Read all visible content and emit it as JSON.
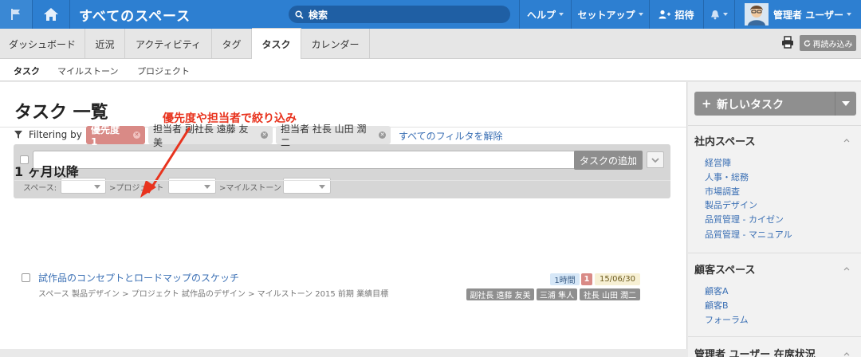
{
  "topbar": {
    "space_title": "すべてのスペース",
    "search_placeholder": "検索",
    "help": "ヘルプ",
    "setup": "セットアップ",
    "invite": "招待",
    "user_name": "管理者 ユーザー",
    "colors": {
      "bar": "#2d7fd1",
      "search": "#1f5fa4"
    }
  },
  "tabs": [
    {
      "label": "ダッシュボード"
    },
    {
      "label": "近況"
    },
    {
      "label": "アクティビティ"
    },
    {
      "label": "タグ"
    },
    {
      "label": "タスク",
      "active": true
    },
    {
      "label": "カレンダー"
    }
  ],
  "toolbar": {
    "reload_label": "再読み込み"
  },
  "subnav": [
    {
      "label": "タスク",
      "active": true
    },
    {
      "label": "マイルストーン"
    },
    {
      "label": "プロジェクト"
    }
  ],
  "main": {
    "page_title": "タスク 一覧",
    "annotation": "優先度や担当者で絞り込み",
    "filter": {
      "add_task_label": "タスクの追加",
      "space_label": "スペース:",
      "project_label": ">プロジェクト",
      "milestone_label": ">マイルストーン"
    },
    "filtering": {
      "label": "Filtering by",
      "chips": [
        "優先度 1",
        "担当者 副社長 遠藤 友美",
        "担当者 社長 山田 潤二"
      ],
      "clear_all": "すべてのフィルタを解除"
    },
    "section": "1 ヶ月以降",
    "task": {
      "title": "試作品のコンセプトとロードマップのスケッチ",
      "path": "スペース 製品デザイン > プロジェクト 試作品のデザイン > マイルストーン 2015 前期 業績目標",
      "duration": "1時間",
      "priority": "1",
      "date": "15/06/30",
      "assignees": [
        "副社長 遠藤 友美",
        "三浦 隼人",
        "社長 山田 潤二"
      ]
    }
  },
  "sidebar": {
    "new_task": "新しいタスク",
    "internal_title": "社内スペース",
    "internal_links": [
      "経営陣",
      "人事・総務",
      "市場調査",
      "製品デザイン",
      "品質管理 - カイゼン",
      "品質管理 - マニュアル"
    ],
    "customer_title": "顧客スペース",
    "customer_links": [
      "顧客A",
      "顧客B",
      "フォーラム"
    ],
    "presence_title": "管理者 ユーザー 在席状況"
  }
}
